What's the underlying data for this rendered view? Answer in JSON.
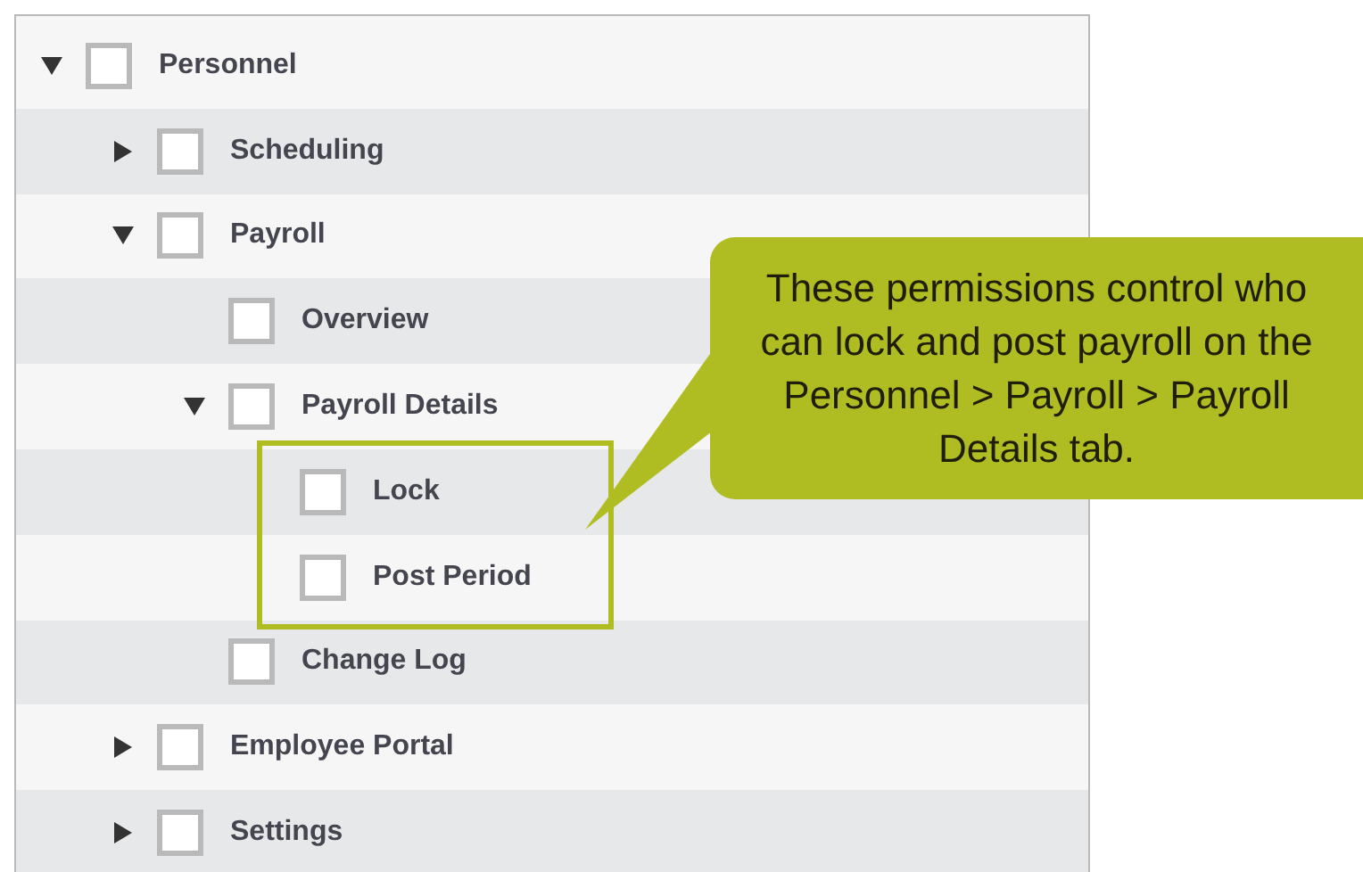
{
  "tree": [
    {
      "label": "Personnel",
      "checked": false,
      "expanded": true,
      "children": [
        {
          "label": "Scheduling",
          "checked": false,
          "expanded": false
        },
        {
          "label": "Payroll",
          "checked": false,
          "expanded": true,
          "children": [
            {
              "label": "Overview",
              "checked": false
            },
            {
              "label": "Payroll Details",
              "checked": false,
              "expanded": true,
              "children": [
                {
                  "label": "Lock",
                  "checked": false,
                  "highlighted": true
                },
                {
                  "label": "Post Period",
                  "checked": false,
                  "highlighted": true
                }
              ]
            },
            {
              "label": "Change Log",
              "checked": false
            }
          ]
        },
        {
          "label": "Employee Portal",
          "checked": false,
          "expanded": false
        },
        {
          "label": "Settings",
          "checked": false,
          "expanded": false
        }
      ]
    }
  ],
  "callout": {
    "text": "These permissions control who can lock and post payroll on the Personnel > Payroll > Payroll Details tab."
  }
}
